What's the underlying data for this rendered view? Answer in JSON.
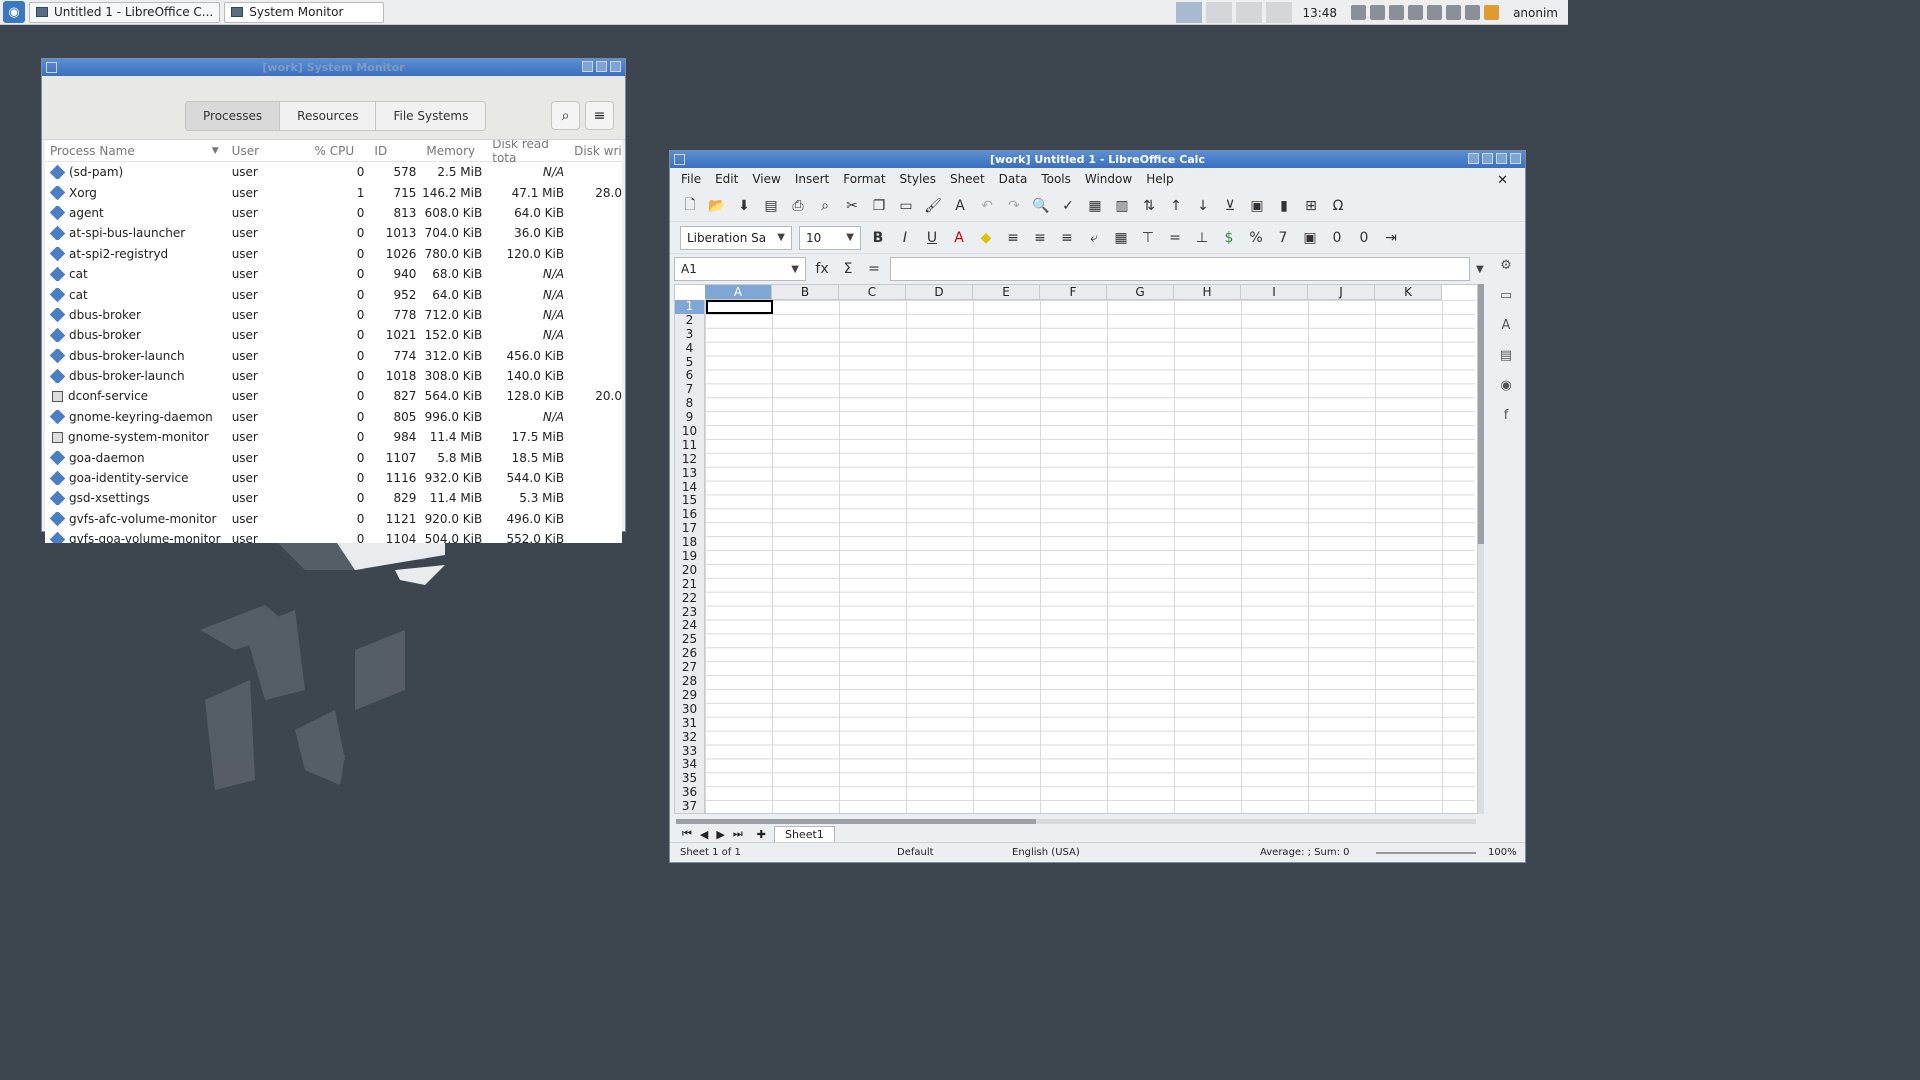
{
  "taskbar": {
    "tasks": [
      {
        "label": "Untitled 1 - LibreOffice C..."
      },
      {
        "label": "System Monitor"
      }
    ],
    "clock": "13:48",
    "user": "anonim"
  },
  "system_monitor": {
    "title": "[work] System Monitor",
    "tabs": [
      "Processes",
      "Resources",
      "File Systems"
    ],
    "columns": [
      "Process Name",
      "User",
      "% CPU",
      "ID",
      "Memory",
      "Disk read tota",
      "Disk writ"
    ],
    "rows": [
      {
        "name": "(sd-pam)",
        "user": "user",
        "cpu": "0",
        "id": "578",
        "mem": "2.5 MiB",
        "read": "N/A",
        "write": ""
      },
      {
        "name": "Xorg",
        "user": "user",
        "cpu": "1",
        "id": "715",
        "mem": "146.2 MiB",
        "read": "47.1 MiB",
        "write": "28.0"
      },
      {
        "name": "agent",
        "user": "user",
        "cpu": "0",
        "id": "813",
        "mem": "608.0 KiB",
        "read": "64.0 KiB",
        "write": ""
      },
      {
        "name": "at-spi-bus-launcher",
        "user": "user",
        "cpu": "0",
        "id": "1013",
        "mem": "704.0 KiB",
        "read": "36.0 KiB",
        "write": ""
      },
      {
        "name": "at-spi2-registryd",
        "user": "user",
        "cpu": "0",
        "id": "1026",
        "mem": "780.0 KiB",
        "read": "120.0 KiB",
        "write": ""
      },
      {
        "name": "cat",
        "user": "user",
        "cpu": "0",
        "id": "940",
        "mem": "68.0 KiB",
        "read": "N/A",
        "write": ""
      },
      {
        "name": "cat",
        "user": "user",
        "cpu": "0",
        "id": "952",
        "mem": "64.0 KiB",
        "read": "N/A",
        "write": ""
      },
      {
        "name": "dbus-broker",
        "user": "user",
        "cpu": "0",
        "id": "778",
        "mem": "712.0 KiB",
        "read": "N/A",
        "write": ""
      },
      {
        "name": "dbus-broker",
        "user": "user",
        "cpu": "0",
        "id": "1021",
        "mem": "152.0 KiB",
        "read": "N/A",
        "write": ""
      },
      {
        "name": "dbus-broker-launch",
        "user": "user",
        "cpu": "0",
        "id": "774",
        "mem": "312.0 KiB",
        "read": "456.0 KiB",
        "write": ""
      },
      {
        "name": "dbus-broker-launch",
        "user": "user",
        "cpu": "0",
        "id": "1018",
        "mem": "308.0 KiB",
        "read": "140.0 KiB",
        "write": ""
      },
      {
        "name": "dconf-service",
        "user": "user",
        "cpu": "0",
        "id": "827",
        "mem": "564.0 KiB",
        "read": "128.0 KiB",
        "write": "20.0"
      },
      {
        "name": "gnome-keyring-daemon",
        "user": "user",
        "cpu": "0",
        "id": "805",
        "mem": "996.0 KiB",
        "read": "N/A",
        "write": ""
      },
      {
        "name": "gnome-system-monitor",
        "user": "user",
        "cpu": "0",
        "id": "984",
        "mem": "11.4 MiB",
        "read": "17.5 MiB",
        "write": ""
      },
      {
        "name": "goa-daemon",
        "user": "user",
        "cpu": "0",
        "id": "1107",
        "mem": "5.8 MiB",
        "read": "18.5 MiB",
        "write": ""
      },
      {
        "name": "goa-identity-service",
        "user": "user",
        "cpu": "0",
        "id": "1116",
        "mem": "932.0 KiB",
        "read": "544.0 KiB",
        "write": ""
      },
      {
        "name": "gsd-xsettings",
        "user": "user",
        "cpu": "0",
        "id": "829",
        "mem": "11.4 MiB",
        "read": "5.3 MiB",
        "write": ""
      },
      {
        "name": "gvfs-afc-volume-monitor",
        "user": "user",
        "cpu": "0",
        "id": "1121",
        "mem": "920.0 KiB",
        "read": "496.0 KiB",
        "write": ""
      },
      {
        "name": "gvfs-goa-volume-monitor",
        "user": "user",
        "cpu": "0",
        "id": "1104",
        "mem": "504.0 KiB",
        "read": "552.0 KiB",
        "write": ""
      }
    ]
  },
  "calc": {
    "title": "[work] Untitled 1 - LibreOffice Calc",
    "menu": [
      "File",
      "Edit",
      "View",
      "Insert",
      "Format",
      "Styles",
      "Sheet",
      "Data",
      "Tools",
      "Window",
      "Help"
    ],
    "font_name": "Liberation Sa",
    "font_size": "10",
    "name_box": "A1",
    "columns": [
      "A",
      "B",
      "C",
      "D",
      "E",
      "F",
      "G",
      "H",
      "I",
      "J",
      "K"
    ],
    "rows": [
      "1",
      "2",
      "3",
      "4",
      "5",
      "6",
      "7",
      "8",
      "9",
      "10",
      "11",
      "12",
      "13",
      "14",
      "15",
      "16",
      "17",
      "18",
      "19",
      "20",
      "21",
      "22",
      "23",
      "24",
      "25",
      "26",
      "27",
      "28",
      "29",
      "30",
      "31",
      "32",
      "33",
      "34",
      "35",
      "36",
      "37"
    ],
    "sheet_tab": "Sheet1",
    "status": {
      "sheet": "Sheet 1 of 1",
      "style": "Default",
      "language": "English (USA)",
      "summary": "Average: ; Sum: 0",
      "zoom": "100%"
    }
  }
}
